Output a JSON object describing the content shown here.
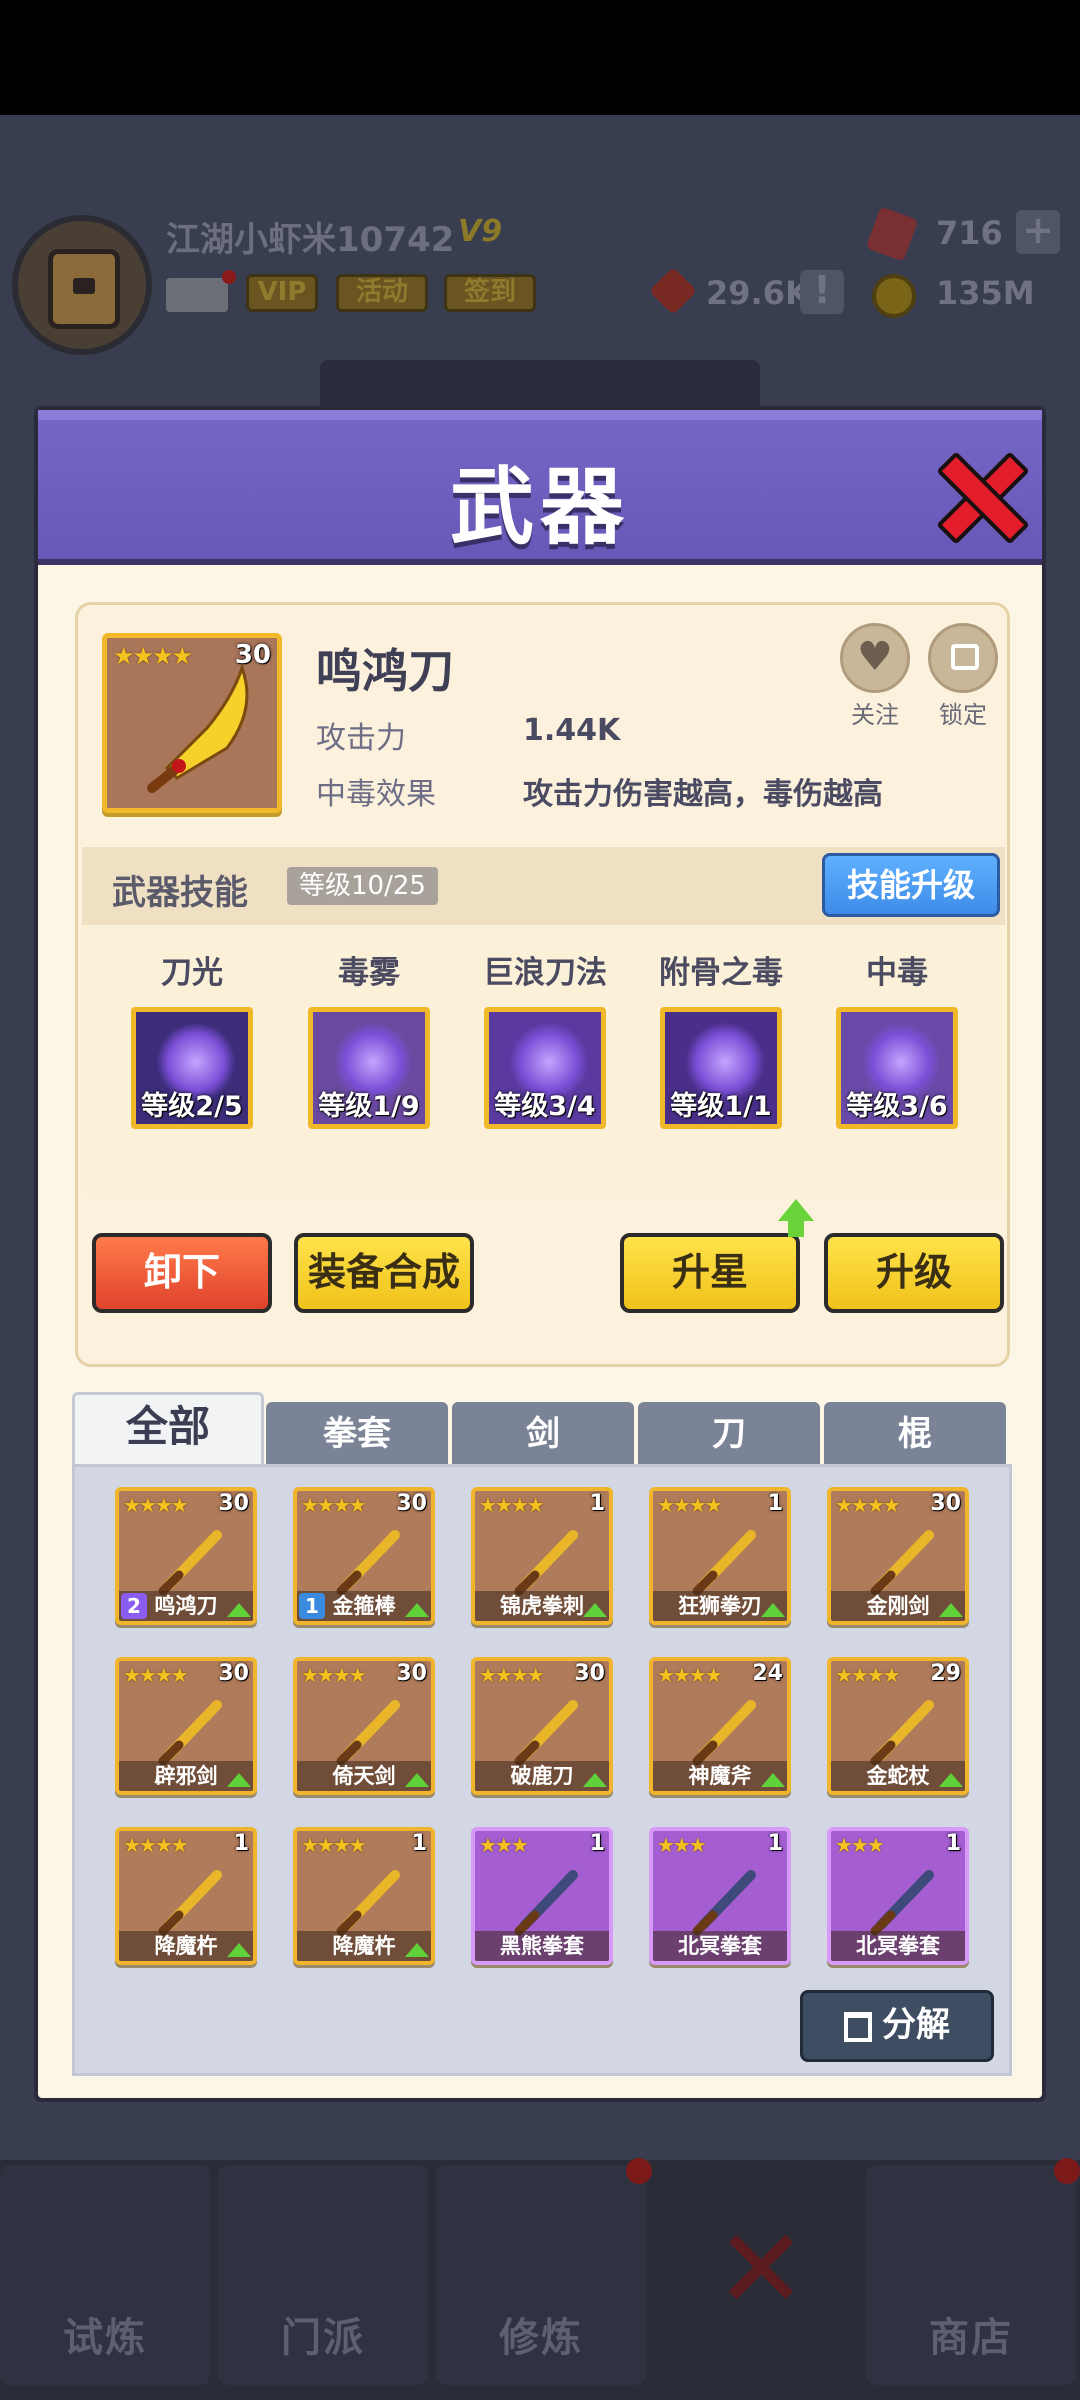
{
  "player": {
    "name": "江湖小虾米10742",
    "vip_level": "V9",
    "gems": "716",
    "power": "29.6K",
    "coins": "135M"
  },
  "hud_buttons": [
    "VIP",
    "活动",
    "签到"
  ],
  "bottom_nav": [
    {
      "label": "试炼"
    },
    {
      "label": "门派"
    },
    {
      "label": "修炼"
    },
    {
      "label": ""
    },
    {
      "label": "商店"
    }
  ],
  "modal": {
    "title": "武器",
    "weapon": {
      "name": "鸣鸿刀",
      "stars": "★★★★",
      "level": "30",
      "attack_label": "攻击力",
      "attack_value": "1.44K",
      "effect_label": "中毒效果",
      "effect_value": "攻击力伤害越高，毒伤越高"
    },
    "follow_label": "关注",
    "lock_label": "锁定",
    "skills_title": "武器技能",
    "skills_level": "等级10/25",
    "skill_upgrade": "技能升级",
    "skills": [
      {
        "name": "刀光",
        "level": "等级2/5"
      },
      {
        "name": "毒雾",
        "level": "等级1/9"
      },
      {
        "name": "巨浪刀法",
        "level": "等级3/4"
      },
      {
        "name": "附骨之毒",
        "level": "等级1/1"
      },
      {
        "name": "中毒",
        "level": "等级3/6"
      }
    ],
    "actions": {
      "unequip": "卸下",
      "craft": "装备合成",
      "star_up": "升星",
      "upgrade": "升级"
    },
    "tabs": [
      "全部",
      "拳套",
      "剑",
      "刀",
      "棍"
    ],
    "inventory": [
      {
        "name": "鸣鸿刀",
        "stars": "★★★★",
        "level": "30",
        "badge": "2",
        "rarity": "gold"
      },
      {
        "name": "金箍棒",
        "stars": "★★★★",
        "level": "30",
        "badge": "1",
        "rarity": "gold"
      },
      {
        "name": "锦虎拳刺",
        "stars": "★★★★",
        "level": "1",
        "badge": "",
        "rarity": "gold"
      },
      {
        "name": "狂狮拳刃",
        "stars": "★★★★",
        "level": "1",
        "badge": "",
        "rarity": "gold"
      },
      {
        "name": "金刚剑",
        "stars": "★★★★",
        "level": "30",
        "badge": "",
        "rarity": "gold"
      },
      {
        "name": "辟邪剑",
        "stars": "★★★★",
        "level": "30",
        "badge": "",
        "rarity": "gold"
      },
      {
        "name": "倚天剑",
        "stars": "★★★★",
        "level": "30",
        "badge": "",
        "rarity": "gold"
      },
      {
        "name": "破鹿刀",
        "stars": "★★★★",
        "level": "30",
        "badge": "",
        "rarity": "gold"
      },
      {
        "name": "神魔斧",
        "stars": "★★★★",
        "level": "24",
        "badge": "",
        "rarity": "gold"
      },
      {
        "name": "金蛇杖",
        "stars": "★★★★",
        "level": "29",
        "badge": "",
        "rarity": "gold"
      },
      {
        "name": "降魔杵",
        "stars": "★★★★",
        "level": "1",
        "badge": "",
        "rarity": "gold"
      },
      {
        "name": "降魔杵",
        "stars": "★★★★",
        "level": "1",
        "badge": "",
        "rarity": "gold"
      },
      {
        "name": "黑熊拳套",
        "stars": "★★★",
        "level": "1",
        "badge": "",
        "rarity": "purple"
      },
      {
        "name": "北冥拳套",
        "stars": "★★★",
        "level": "1",
        "badge": "",
        "rarity": "purple"
      },
      {
        "name": "北冥拳套",
        "stars": "★★★",
        "level": "1",
        "badge": "",
        "rarity": "purple"
      }
    ],
    "decompose": "分解"
  }
}
